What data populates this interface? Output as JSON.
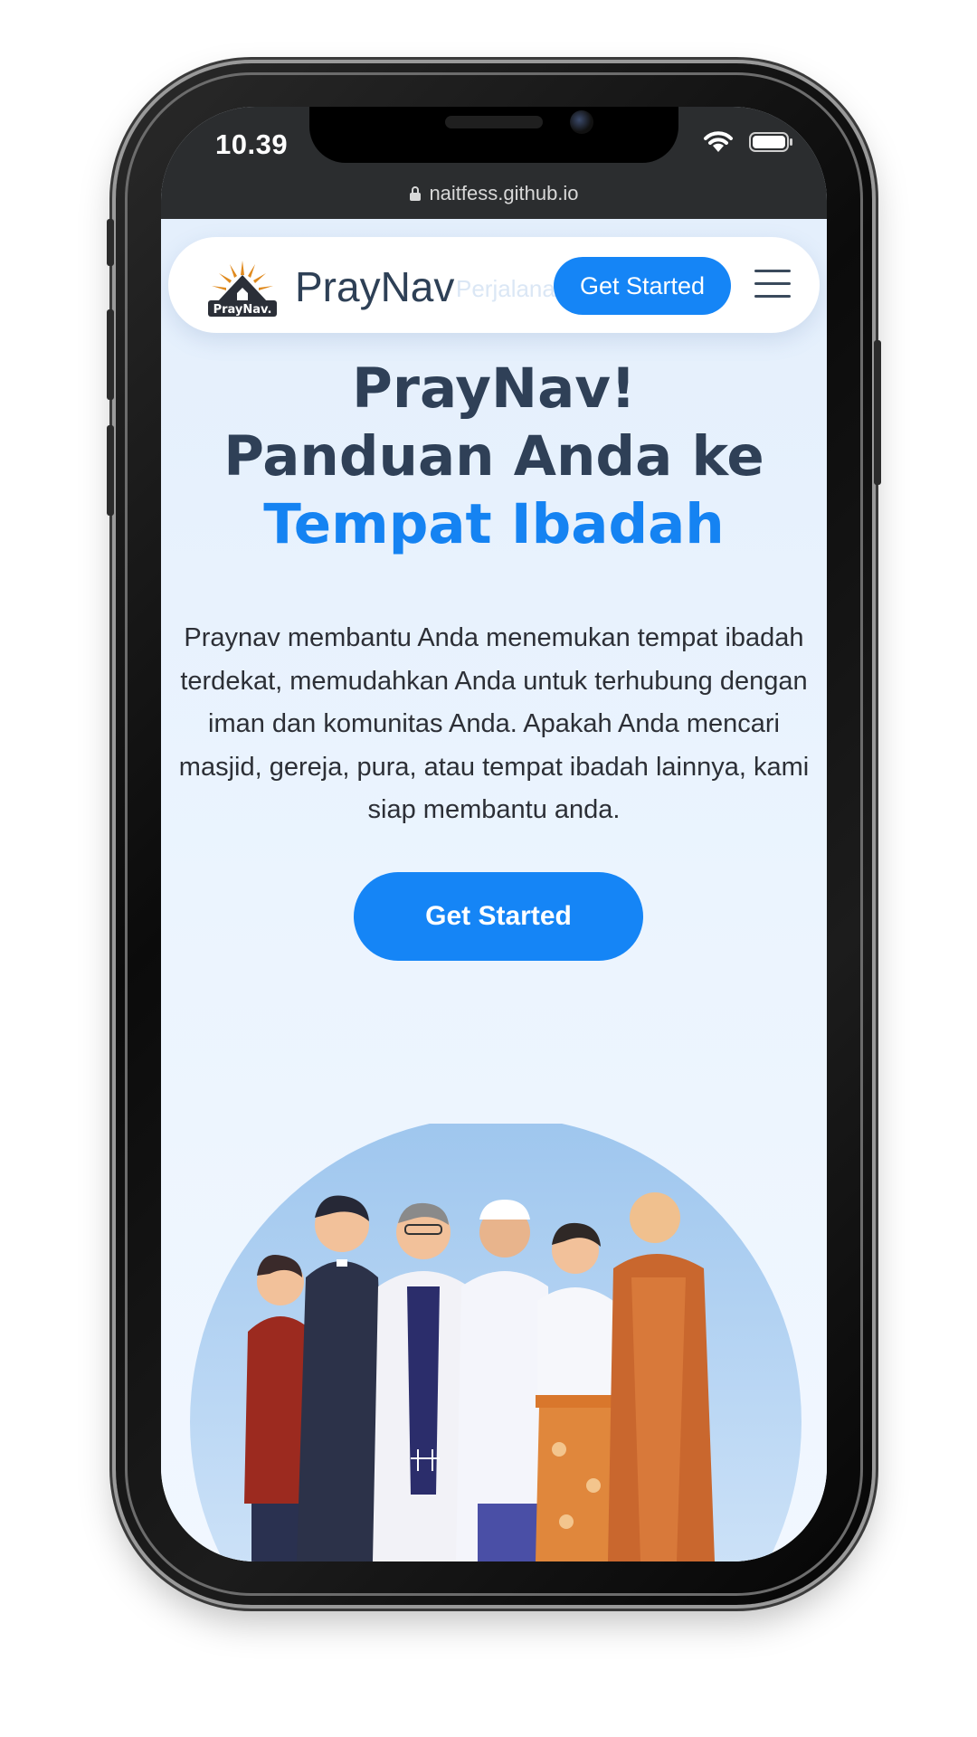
{
  "status_bar": {
    "time": "10.39",
    "wifi_icon": "wifi-icon",
    "battery_icon": "battery-icon"
  },
  "browser": {
    "url": "naitfess.github.io",
    "lock_icon": "lock-icon"
  },
  "navbar": {
    "brand": "PrayNav",
    "logo_text": "PrayNav.",
    "ghost_text": "Perjalanan",
    "cta_label": "Get Started",
    "menu_icon": "hamburger-icon"
  },
  "hero": {
    "title_line1": "PrayNav!",
    "title_line2": "Panduan Anda ke",
    "title_line3": "Tempat Ibadah",
    "description": "Praynav membantu Anda menemukan tempat ibadah terdekat, memudahkan Anda untuk terhubung dengan iman dan komunitas Anda. Apakah Anda mencari masjid, gereja, pura, atau tempat ibadah lainnya, kami siap membantu anda.",
    "cta_label": "Get Started"
  },
  "scroll_top_icon": "arrow-up-icon",
  "colors": {
    "primary": "#1585f6",
    "heading": "#2f4057",
    "background": "#e8f2fd"
  }
}
